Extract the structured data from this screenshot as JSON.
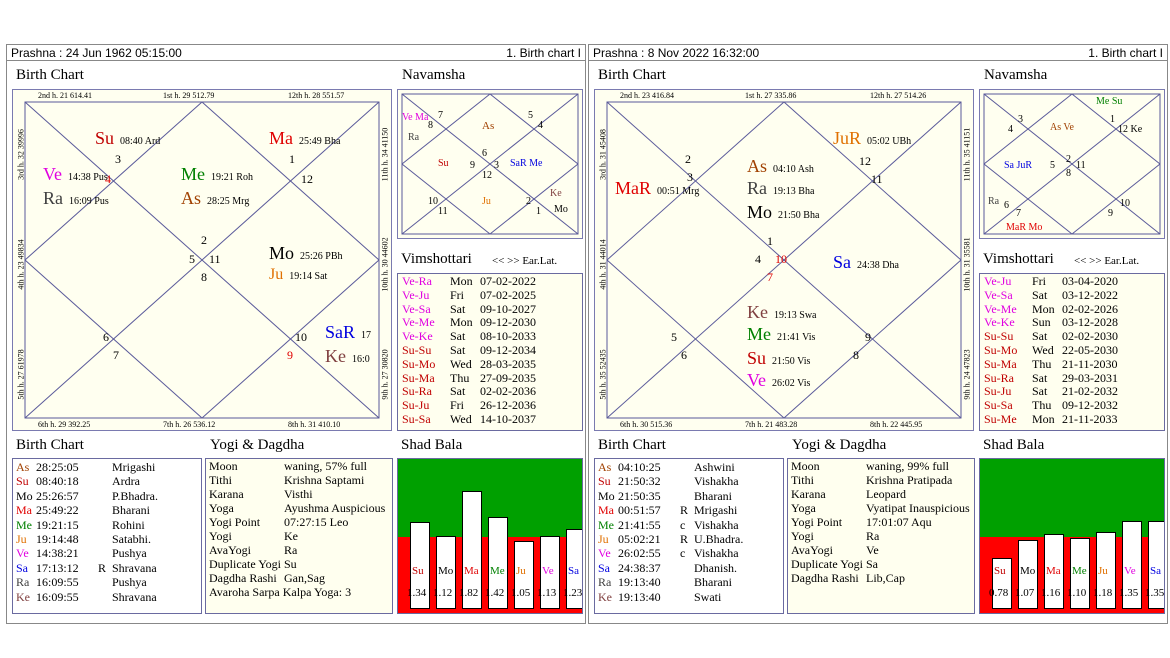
{
  "panels": [
    {
      "header_left": "Prashna :  24 Jun 1962  05:15:00",
      "header_right": "1. Birth chart I",
      "birth_chart_title": "Birth Chart",
      "navamsha_title": "Navamsha",
      "vimshottari_title": "Vimshottari",
      "vim_nav": "<< >> Ear.Lat.",
      "table_title": "Birth Chart",
      "yogi_title": "Yogi & Dagdha",
      "shad_title": "Shad Bala",
      "house_labels": {
        "top1": "2nd h.  21  614.41",
        "top2": "1st h.  29  512.79",
        "top3": "12th h.  28  551.57",
        "bot1": "6th h.  29  392.25",
        "bot2": "7th h.  26  536.12",
        "bot3": "8th h.  31  410.10",
        "left1": "3rd h.  32  39996",
        "left2": "4th h.  23  49834",
        "left3": "5th h.  27  61978",
        "right1": "11th h.  34  41150",
        "right2": "10th h.  30  44602",
        "right3": "9th h.  27  30820"
      },
      "rasi": {
        "n1": "1",
        "n2": "2",
        "n3": "3",
        "n4": "4",
        "n5": "5",
        "n6": "6",
        "n7": "7",
        "n8": "8",
        "n9": "9",
        "n10": "10",
        "n11": "11",
        "n12": "12"
      },
      "planets": [
        {
          "p": "Su",
          "d": "08:40  Ard",
          "c": "#c00000"
        },
        {
          "p": "Ma",
          "d": "25:49  Bha",
          "c": "#e00000"
        },
        {
          "p": "Ve",
          "d": "14:38  Pus",
          "c": "#e000e0"
        },
        {
          "p": "Ra",
          "d": "16:09  Pus",
          "c": "#404040"
        },
        {
          "p": "Me",
          "d": "19:21  Roh",
          "c": "#008000"
        },
        {
          "p": "As",
          "d": "28:25  Mrg",
          "c": "#a04000"
        },
        {
          "p": "Mo",
          "d": "25:26  PBh",
          "c": "#000000"
        },
        {
          "p": "Ju",
          "d": "19:14  Sat",
          "c": "#e07000"
        },
        {
          "p": "SaR",
          "d": "17",
          "c": "#0000e0"
        },
        {
          "p": "Ke",
          "d": "16:0",
          "c": "#804040"
        }
      ],
      "nav": {
        "a": "Ve Ma",
        "b": "Ra",
        "c": "8",
        "d": "7",
        "e": "As",
        "f": "5",
        "g": "4",
        "h": "Su",
        "i": "6",
        "j": "9",
        "k": "3",
        "l": "12",
        "m": "SaR Me",
        "n": "10",
        "o": "11",
        "p": "Ju",
        "q": "2",
        "r": "1",
        "s": "Ke",
        "t": "Mo"
      },
      "vimshottari": [
        [
          "Ve-Ra",
          "Mon",
          "07-02-2022"
        ],
        [
          "Ve-Ju",
          "Fri",
          "07-02-2025"
        ],
        [
          "Ve-Sa",
          "Sat",
          "09-10-2027"
        ],
        [
          "Ve-Me",
          "Mon",
          "09-12-2030"
        ],
        [
          "Ve-Ke",
          "Sat",
          "08-10-2033"
        ],
        [
          "Su-Su",
          "Sat",
          "09-12-2034"
        ],
        [
          "Su-Mo",
          "Wed",
          "28-03-2035"
        ],
        [
          "Su-Ma",
          "Thu",
          "27-09-2035"
        ],
        [
          "Su-Ra",
          "Sat",
          "02-02-2036"
        ],
        [
          "Su-Ju",
          "Fri",
          "26-12-2036"
        ],
        [
          "Su-Sa",
          "Wed",
          "14-10-2037"
        ]
      ],
      "positions": [
        [
          "As",
          "28:25:05",
          "",
          "Mrigashi"
        ],
        [
          "Su",
          "08:40:18",
          "",
          "Ardra"
        ],
        [
          "Mo",
          "25:26:57",
          "",
          "P.Bhadra."
        ],
        [
          "Ma",
          "25:49:22",
          "",
          "Bharani"
        ],
        [
          "Me",
          "19:21:15",
          "",
          "Rohini"
        ],
        [
          "Ju",
          "19:14:48",
          "",
          "Satabhi."
        ],
        [
          "Ve",
          "14:38:21",
          "",
          "Pushya"
        ],
        [
          "Sa",
          "17:13:12",
          "R",
          "Shravana"
        ],
        [
          "Ra",
          "16:09:55",
          "",
          "Pushya"
        ],
        [
          "Ke",
          "16:09:55",
          "",
          "Shravana"
        ]
      ],
      "yogi": [
        [
          "Moon",
          "waning, 57% full"
        ],
        [
          "Tithi",
          "Krishna  Saptami"
        ],
        [
          "Karana",
          "Visthi"
        ],
        [
          "Yoga",
          "Ayushma Auspicious"
        ],
        [
          "Yogi Point",
          "07:27:15 Leo"
        ],
        [
          "Yogi",
          "Ke"
        ],
        [
          "AvaYogi",
          "Ra"
        ],
        [
          "Duplicate Yogi",
          "Su"
        ],
        [
          "Dagdha Rashi",
          "Gan,Sag"
        ]
      ],
      "yogi_extra": "Avaroha Sarpa Kalpa Yoga: 3",
      "shad": {
        "labels": [
          "Su",
          "Mo",
          "Ma",
          "Me",
          "Ju",
          "Ve",
          "Sa"
        ],
        "values": [
          "1.34",
          "1.12",
          "1.82",
          "1.42",
          "1.05",
          "1.13",
          "1.23"
        ],
        "heights": [
          1.34,
          1.12,
          1.82,
          1.42,
          1.05,
          1.13,
          1.23
        ]
      }
    },
    {
      "header_left": "Prashna :  8 Nov 2022  16:32:00",
      "header_right": "1. Birth chart I",
      "birth_chart_title": "Birth Chart",
      "navamsha_title": "Navamsha",
      "vimshottari_title": "Vimshottari",
      "vim_nav": "<< >> Ear.Lat.",
      "table_title": "Birth Chart",
      "yogi_title": "Yogi & Dagdha",
      "shad_title": "Shad Bala",
      "house_labels": {
        "top1": "2nd h.  23  416.84",
        "top2": "1st h.  27  335.86",
        "top3": "12th h.  27  514.26",
        "bot1": "6th h.  30  515.36",
        "bot2": "7th h.  21  483.28",
        "bot3": "8th h.  22  445.95",
        "left1": "3rd h.  31  45408",
        "left2": "4th h.  31  44014",
        "left3": "5th h.  35  52435",
        "right1": "11th h.  35  41151",
        "right2": "10th h.  31  35581",
        "right3": "9th h.  24  47823"
      },
      "rasi": {
        "n1": "1",
        "n2": "2",
        "n3": "3",
        "n4": "4",
        "n5": "5",
        "n6": "6",
        "n7": "7",
        "n8": "8",
        "n9": "9",
        "n10": "10",
        "n11": "11",
        "n12": "12"
      },
      "planets": [
        {
          "p": "JuR",
          "d": "05:02  UBh",
          "c": "#e07000"
        },
        {
          "p": "MaR",
          "d": "00:51  Mrg",
          "c": "#e00000"
        },
        {
          "p": "As",
          "d": "04:10  Ash",
          "c": "#a04000"
        },
        {
          "p": "Ra",
          "d": "19:13  Bha",
          "c": "#404040"
        },
        {
          "p": "Mo",
          "d": "21:50  Bha",
          "c": "#000000"
        },
        {
          "p": "Sa",
          "d": "24:38  Dha",
          "c": "#0000e0"
        },
        {
          "p": "Ke",
          "d": "19:13  Swa",
          "c": "#804040"
        },
        {
          "p": "Me",
          "d": "21:41  Vis",
          "c": "#008000"
        },
        {
          "p": "Su",
          "d": "21:50  Vis",
          "c": "#c00000"
        },
        {
          "p": "Ve",
          "d": "26:02  Vis",
          "c": "#e000e0"
        }
      ],
      "nav": {
        "a": "Me Su",
        "b": "3",
        "c": "4",
        "d": "As Ve",
        "e": "1",
        "f": "12 Ke",
        "g": "Sa JuR",
        "h": "5",
        "i": "2",
        "j": "11",
        "k": "8",
        "l": "Ra",
        "m": "6",
        "n": "7",
        "o": "10",
        "p": "9",
        "q": "MaR Mo"
      },
      "vimshottari": [
        [
          "Ve-Ju",
          "Fri",
          "03-04-2020"
        ],
        [
          "Ve-Sa",
          "Sat",
          "03-12-2022"
        ],
        [
          "Ve-Me",
          "Mon",
          "02-02-2026"
        ],
        [
          "Ve-Ke",
          "Sun",
          "03-12-2028"
        ],
        [
          "Su-Su",
          "Sat",
          "02-02-2030"
        ],
        [
          "Su-Mo",
          "Wed",
          "22-05-2030"
        ],
        [
          "Su-Ma",
          "Thu",
          "21-11-2030"
        ],
        [
          "Su-Ra",
          "Sat",
          "29-03-2031"
        ],
        [
          "Su-Ju",
          "Sat",
          "21-02-2032"
        ],
        [
          "Su-Sa",
          "Thu",
          "09-12-2032"
        ],
        [
          "Su-Me",
          "Mon",
          "21-11-2033"
        ]
      ],
      "positions": [
        [
          "As",
          "04:10:25",
          "",
          "Ashwini"
        ],
        [
          "Su",
          "21:50:32",
          "",
          "Vishakha"
        ],
        [
          "Mo",
          "21:50:35",
          "",
          "Bharani"
        ],
        [
          "Ma",
          "00:51:57",
          "R",
          "Mrigashi"
        ],
        [
          "Me",
          "21:41:55",
          "c",
          "Vishakha"
        ],
        [
          "Ju",
          "05:02:21",
          "R",
          "U.Bhadra."
        ],
        [
          "Ve",
          "26:02:55",
          "c",
          "Vishakha"
        ],
        [
          "Sa",
          "24:38:37",
          "",
          "Dhanish."
        ],
        [
          "Ra",
          "19:13:40",
          "",
          "Bharani"
        ],
        [
          "Ke",
          "19:13:40",
          "",
          "Swati"
        ]
      ],
      "yogi": [
        [
          "Moon",
          "waning, 99% full"
        ],
        [
          "Tithi",
          "Krishna  Pratipada"
        ],
        [
          "Karana",
          "Leopard"
        ],
        [
          "Yoga",
          "Vyatipat Inauspicious"
        ],
        [
          "Yogi Point",
          "17:01:07 Aqu"
        ],
        [
          "Yogi",
          "Ra"
        ],
        [
          "AvaYogi",
          "Ve"
        ],
        [
          "Duplicate Yogi",
          "Sa"
        ],
        [
          "Dagdha Rashi",
          "Lib,Cap"
        ]
      ],
      "yogi_extra": "",
      "shad": {
        "labels": [
          "Su",
          "Mo",
          "Ma",
          "Me",
          "Ju",
          "Ve",
          "Sa"
        ],
        "values": [
          "0.78",
          "1.07",
          "1.16",
          "1.10",
          "1.18",
          "1.35",
          "1.35"
        ],
        "heights": [
          0.78,
          1.07,
          1.16,
          1.1,
          1.18,
          1.35,
          1.35
        ]
      }
    }
  ],
  "colors": {
    "Su": "#c00000",
    "Mo": "#000000",
    "Ma": "#e00000",
    "Me": "#008000",
    "Ju": "#e07000",
    "Ve": "#e000e0",
    "Sa": "#0000e0",
    "Ra": "#404040",
    "Ke": "#804040",
    "As": "#a04000",
    "green": "#00a000",
    "red": "#ff0000"
  }
}
